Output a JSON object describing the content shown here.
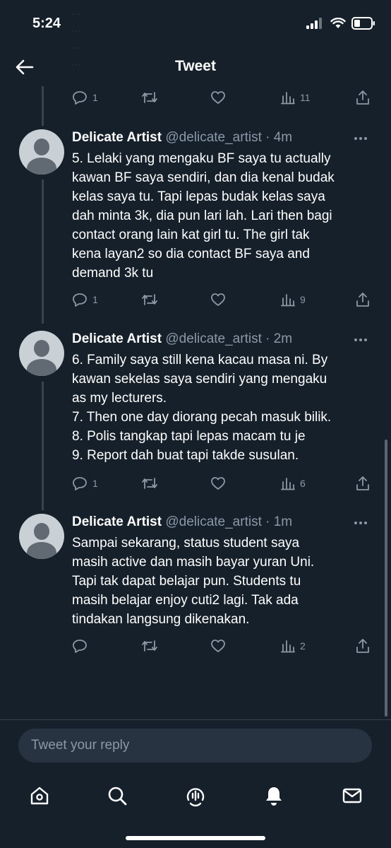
{
  "status_bar": {
    "time": "5:24"
  },
  "header": {
    "title": "Tweet"
  },
  "ghost_text": "... \n... \n... \n...",
  "top_actions": {
    "replies": "1",
    "retweets": "",
    "likes": "",
    "views": "11"
  },
  "tweets": [
    {
      "name": "Delicate Artist",
      "meta": "@delicate_artist · 4m",
      "text": "5. Lelaki yang mengaku BF saya tu actually\nkawan BF saya sendiri, dan dia kenal budak\nkelas saya tu. Tapi lepas budak kelas saya\ndah minta 3k, dia pun lari lah. Lari then bagi\ncontact orang lain kat girl tu. The girl tak\nkena layan2 so dia contact BF saya and\ndemand 3k tu",
      "replies": "1",
      "views": "9"
    },
    {
      "name": "Delicate Artist",
      "meta": "@delicate_artist · 2m",
      "text": "6. Family saya still kena kacau masa ni. By\nkawan sekelas saya sendiri yang mengaku\nas my lecturers.\n7. Then one day diorang pecah masuk bilik.\n8. Polis tangkap tapi lepas macam tu je\n9. Report dah buat tapi takde susulan.",
      "replies": "1",
      "views": "6"
    },
    {
      "name": "Delicate Artist",
      "meta": "@delicate_artist · 1m",
      "text": "Sampai sekarang, status student saya\nmasih active dan masih bayar yuran Uni.\nTapi tak dapat belajar pun. Students tu\nmasih belajar enjoy cuti2 lagi. Tak ada\ntindakan langsung dikenakan.",
      "replies": "",
      "views": "2"
    }
  ],
  "reply": {
    "placeholder": "Tweet your reply"
  },
  "tabs": [
    "home-icon",
    "search-icon",
    "spaces-icon",
    "notifications-icon",
    "messages-icon"
  ],
  "colors": {
    "background": "#15202b",
    "muted": "#8b98a5",
    "divider": "#38444d",
    "input_bg": "#273340"
  }
}
